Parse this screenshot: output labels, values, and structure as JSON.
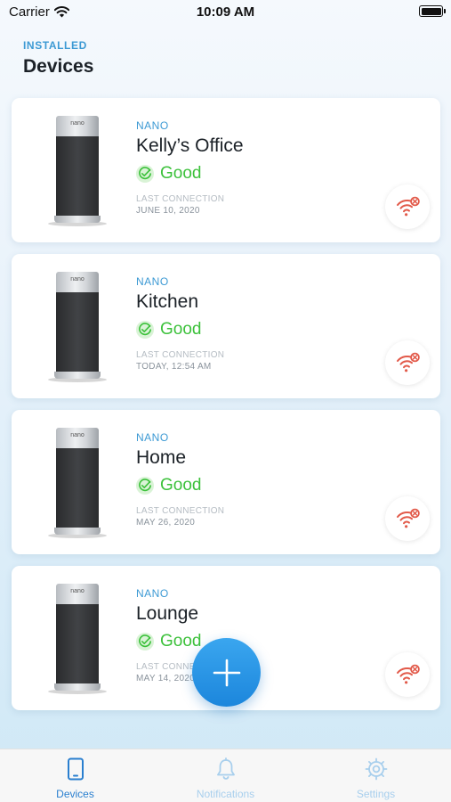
{
  "status_bar": {
    "carrier": "Carrier",
    "time": "10:09 AM"
  },
  "header": {
    "eyebrow": "INSTALLED",
    "title": "Devices"
  },
  "device_logo": "nano",
  "devices": [
    {
      "model": "NANO",
      "name": "Kelly’s Office",
      "status": "Good",
      "last_connection_label": "LAST CONNECTION",
      "last_connection": "JUNE 10, 2020"
    },
    {
      "model": "NANO",
      "name": "Kitchen",
      "status": "Good",
      "last_connection_label": "LAST CONNECTION",
      "last_connection": "TODAY, 12:54 AM"
    },
    {
      "model": "NANO",
      "name": "Home",
      "status": "Good",
      "last_connection_label": "LAST CONNECTION",
      "last_connection": "MAY 26, 2020"
    },
    {
      "model": "NANO",
      "name": "Lounge",
      "status": "Good",
      "last_connection_label": "LAST CONNECTION",
      "last_connection": "MAY 14, 2020"
    }
  ],
  "tabs": [
    {
      "label": "Devices",
      "icon": "phone-icon",
      "active": true
    },
    {
      "label": "Notifications",
      "icon": "bell-icon",
      "active": false
    },
    {
      "label": "Settings",
      "icon": "gear-icon",
      "active": false
    }
  ],
  "colors": {
    "accent": "#2a7fcf",
    "good": "#3cc13b",
    "wifi_error": "#e25a4a",
    "tab_inactive": "#a8cfed"
  }
}
